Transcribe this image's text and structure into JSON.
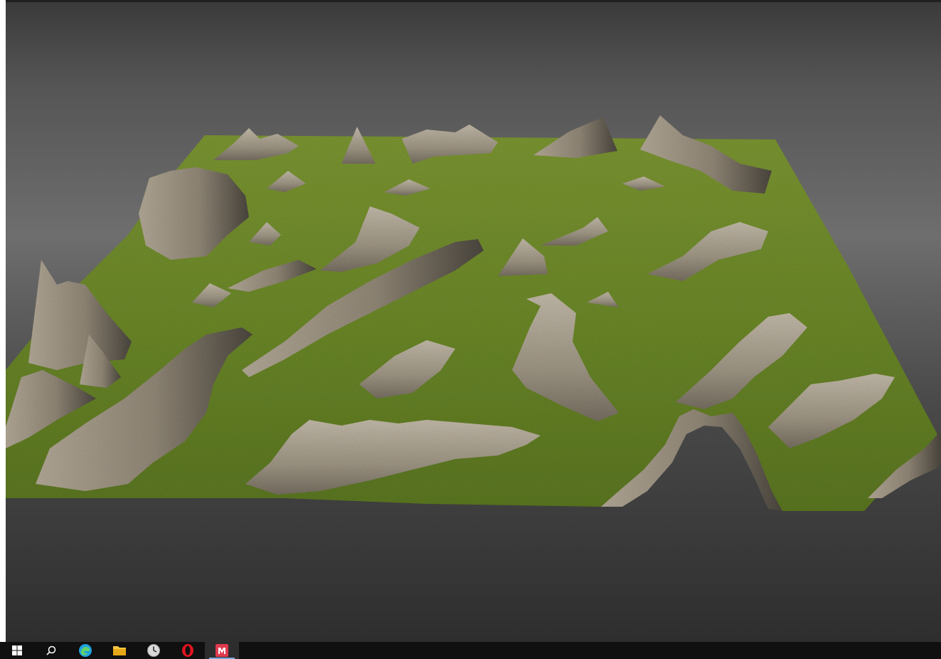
{
  "app": {
    "title": "",
    "scene": "3d-terrain-heightmap-render"
  },
  "viewport": {
    "background_top": "#3a3a3a",
    "background_bottom": "#2e2e2e",
    "terrain_grass_color": "#6f8a2c",
    "terrain_rock_color": "#a79e8e"
  },
  "taskbar": {
    "items": [
      {
        "name": "start",
        "icon": "windows-logo-icon",
        "color": "#ffffff"
      },
      {
        "name": "search",
        "icon": "search-icon",
        "color": "#ffffff"
      },
      {
        "name": "edge",
        "icon": "edge-browser-icon",
        "color": "#1fa0e0"
      },
      {
        "name": "file-explorer",
        "icon": "folder-icon",
        "color": "#f5c542"
      },
      {
        "name": "clock-app",
        "icon": "clock-icon",
        "color": "#d9d9d9"
      },
      {
        "name": "opera",
        "icon": "opera-browser-icon",
        "color": "#e0141e"
      },
      {
        "name": "running-app",
        "icon": "app-icon",
        "color": "#e03a4e"
      }
    ]
  }
}
